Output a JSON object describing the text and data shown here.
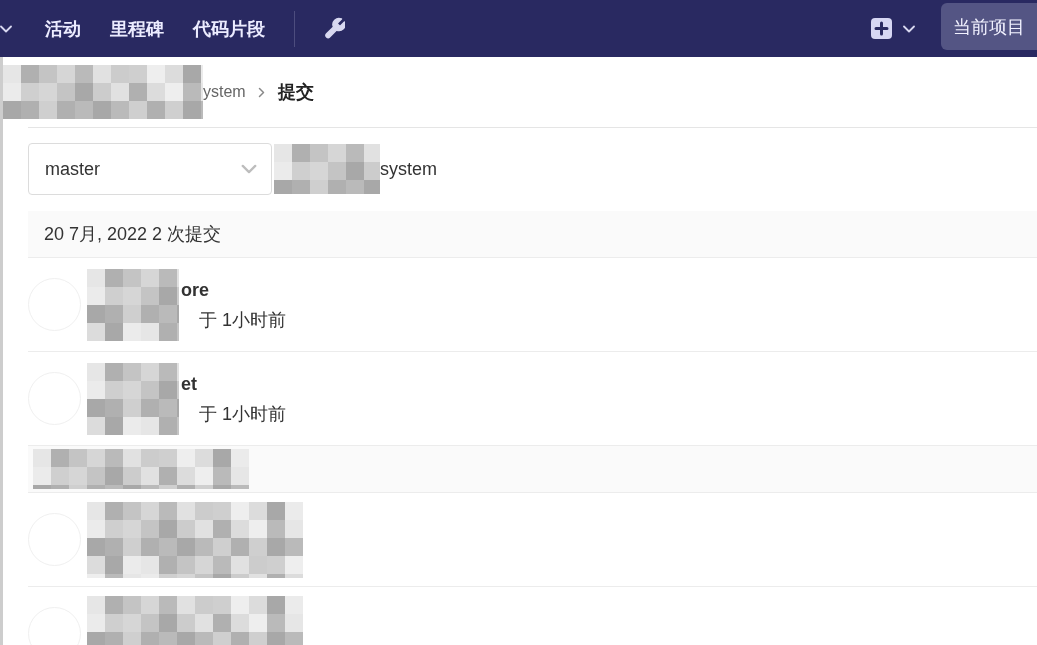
{
  "top_nav": {
    "items": [
      {
        "label": "活动"
      },
      {
        "label": "里程碑"
      },
      {
        "label": "代码片段"
      }
    ],
    "current_project_button": "当前项目"
  },
  "breadcrumb": [
    {
      "label": "ystem",
      "redacted": true,
      "current": false
    },
    {
      "label": "提交",
      "redacted": false,
      "current": true
    }
  ],
  "branch_dropdown": {
    "value": "master"
  },
  "project_path": {
    "text": "system",
    "redacted": true
  },
  "commit_groups": [
    {
      "header": "20 7月, 2022 2 次提交",
      "redacted": false,
      "commits": [
        {
          "title": "ore",
          "meta": "于 1小时前",
          "redacted": true
        },
        {
          "title": "et",
          "meta": "于 1小时前",
          "redacted": true
        }
      ]
    },
    {
      "redacted": true,
      "commits": [
        {
          "redacted": true
        },
        {
          "redacted": true
        }
      ]
    }
  ]
}
